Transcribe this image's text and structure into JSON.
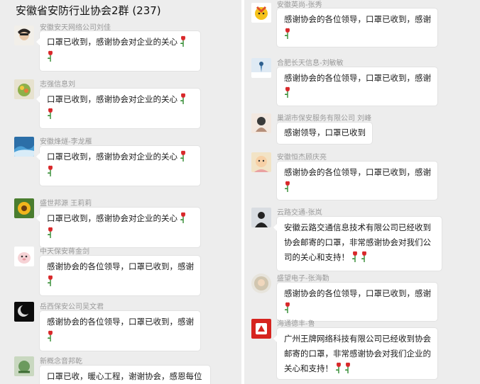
{
  "header": {
    "title": "安徽省安防行业协会2群 (237)"
  },
  "colors": {
    "panel_bg": "#ededed",
    "bubble_bg": "#ffffff",
    "sender_text": "#9a9a9a",
    "rose_red": "#d8282a",
    "rose_stem": "#2f8a2f"
  },
  "icons": {
    "rose": "rose-emoji-icon"
  },
  "left_messages": [
    {
      "sender": "安徽安天网络公司刘佳",
      "text": "口罩已收到，感谢协会对企业的关心",
      "roses": 2
    },
    {
      "sender": "志强信息刘",
      "text": "口罩已收到，感谢协会对企业的关心",
      "roses": 2
    },
    {
      "sender": "安徽烽燧-李龙雁",
      "text": "口罩已收到，感谢协会对企业的关心",
      "roses": 2
    },
    {
      "sender": "盛世邦源 王莉莉",
      "text": "口罩已收到，感谢协会对企业的关心",
      "roses": 2
    },
    {
      "sender": "中天保安蒋金剑",
      "text": "感谢协会的各位领导，口罩已收到，感谢",
      "roses": 1
    },
    {
      "sender": "岳西保安公司吴文君",
      "text": "感谢协会的各位领导，口罩已收到，感谢",
      "roses": 1
    },
    {
      "sender": "新概念音邦乾",
      "text": "口罩已收，暖心工程，谢谢协会，感恩每位",
      "roses": 0
    }
  ],
  "right_messages": [
    {
      "sender": "安徽英尚-张秀",
      "text": "感谢协会的各位领导，口罩已收到，感谢",
      "roses": 1
    },
    {
      "sender": "合肥长天信息-刘敏敏",
      "text": "感谢协会的各位领导，口罩已收到，感谢",
      "roses": 1
    },
    {
      "sender": "巢湖市保安服务有限公司 刘峰",
      "text": "感谢领导，口罩已收到",
      "roses": 0
    },
    {
      "sender": "安徽恒杰顾庆亮",
      "text": "感谢协会的各位领导，口罩已收到，感谢",
      "roses": 1
    },
    {
      "sender": "云路交通-张岚",
      "text": "安徽云路交通信息技术有限公司已经收到协会邮寄的口罩，非常感谢协会对我们公司的关心和支持！",
      "roses": 2
    },
    {
      "sender": "盛望电子-张海勤",
      "text": "感谢协会的各位领导，口罩已收到，感谢",
      "roses": 1
    },
    {
      "sender": "海通德丰-鲁",
      "text": "广州王牌网络科技有限公司已经收到协会邮寄的口罩，非常感谢协会对我们企业的关心和支持！",
      "roses": 2
    }
  ]
}
